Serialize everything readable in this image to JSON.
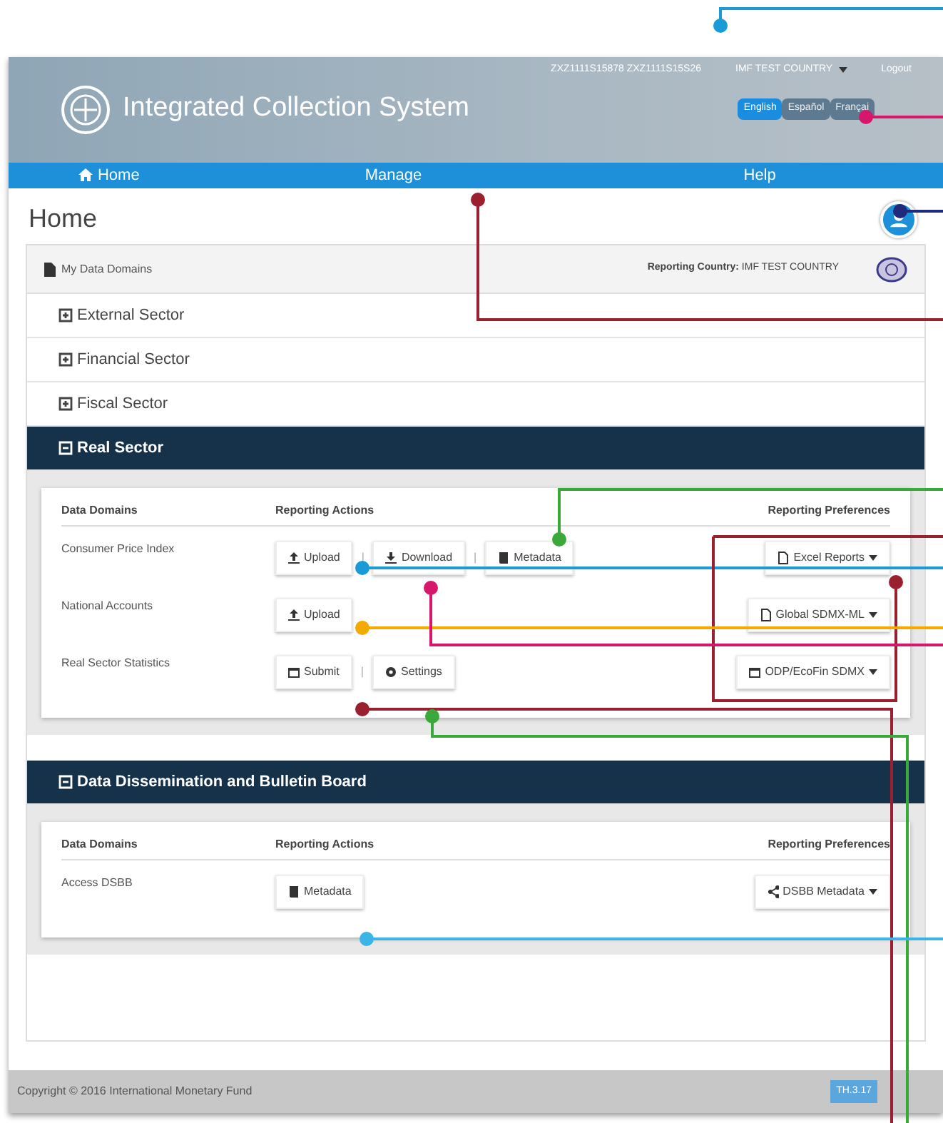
{
  "header": {
    "user_ids": "ZXZ1111S15878 ZXZ1111S15S26",
    "country_menu": "IMF TEST COUNTRY",
    "logout": "Logout",
    "title": "Integrated Collection System",
    "languages": [
      {
        "label": "English",
        "selected": true
      },
      {
        "label": "Español",
        "selected": false
      },
      {
        "label": "Françai",
        "selected": false
      }
    ]
  },
  "nav": [
    {
      "label": "Home",
      "kind": "home"
    },
    {
      "label": "Manage",
      "kind": "plain"
    },
    {
      "label": "Help",
      "kind": "plain"
    }
  ],
  "page_title": "Home",
  "panel": {
    "title": "My Data Domains",
    "reporting_country": "**Reporting Country:** IMF TEST COUNTRY",
    "sectors": [
      {
        "label": "External Sector",
        "expanded": false
      },
      {
        "label": "Financial Sector",
        "expanded": false
      },
      {
        "label": "Fiscal Sector",
        "expanded": false
      },
      {
        "label": "Real Sector",
        "expanded": true,
        "columns": [
          "Data Domains",
          "Reporting Actions",
          "Reporting Preferences"
        ],
        "rows": [
          {
            "domain": "Consumer Price Index",
            "actions": [
              {
                "label": "Upload",
                "kind": "upload"
              },
              {
                "label": "Download",
                "kind": "download"
              },
              {
                "label": "Metadata",
                "kind": "book"
              }
            ],
            "separators": [
              "|",
              "|"
            ],
            "preference": {
              "label": "Excel Reports",
              "kind": "file"
            }
          },
          {
            "domain": "National Accounts",
            "actions": [
              {
                "label": "Upload",
                "kind": "upload"
              }
            ],
            "preference": {
              "label": "Global SDMX-ML",
              "kind": "file"
            }
          },
          {
            "domain": "Real Sector Statistics",
            "actions": [
              {
                "label": "Submit",
                "kind": "calendar"
              },
              {
                "label": "Settings",
                "kind": "gear"
              }
            ],
            "separators": [
              "|"
            ],
            "preference": {
              "label": "ODP/EcoFin SDMX",
              "kind": "calendar"
            }
          }
        ]
      },
      {
        "label": "Data Dissemination and Bulletin Board",
        "expanded": true,
        "columns": [
          "Data Domains",
          "Reporting Actions",
          "Reporting Preferences"
        ],
        "rows": [
          {
            "domain": "Access DSBB",
            "actions": [
              {
                "label": "Metadata",
                "kind": "book"
              }
            ],
            "preference": {
              "label": "DSBB Metadata",
              "kind": "share"
            }
          }
        ]
      }
    ]
  },
  "footer": {
    "copyright": "Copyright © 2016 International Monetary Fund",
    "version": "TH.3.17"
  }
}
